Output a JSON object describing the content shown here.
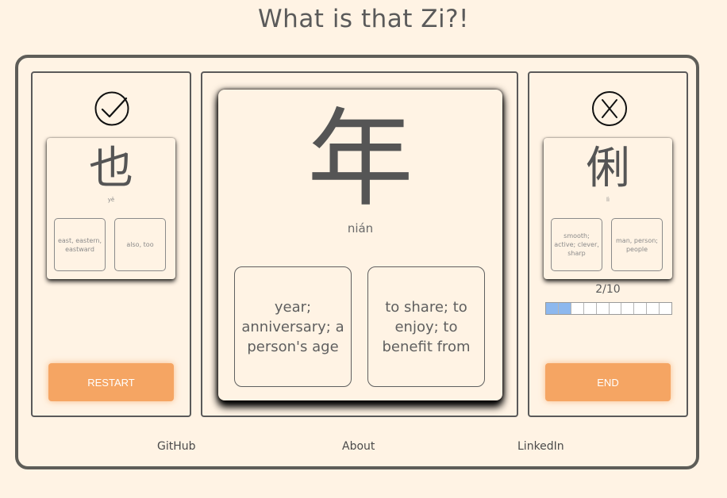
{
  "title": "What is that Zi?!",
  "left": {
    "icon": "check-circle-icon",
    "card": {
      "character": "也",
      "pinyin": "yě",
      "choices": [
        "east, eastern, eastward",
        "also, too"
      ]
    },
    "button": "RESTART"
  },
  "center": {
    "card": {
      "character": "年",
      "pinyin": "nián",
      "choices": [
        "year; anniversary; a person's age",
        "to share; to enjoy; to benefit from"
      ]
    }
  },
  "right": {
    "icon": "x-circle-icon",
    "card": {
      "character": "俐",
      "pinyin": "lì",
      "choices": [
        "smooth; active; clever, sharp",
        "man, person; people"
      ]
    },
    "progress": {
      "text": "2/10",
      "current": 2,
      "total": 10
    },
    "button": "END"
  },
  "footer": {
    "links": [
      "GitHub",
      "About",
      "LinkedIn"
    ]
  },
  "colors": {
    "background": "#fff3e4",
    "accent": "#f5a563",
    "progress": "#8db8ee"
  }
}
